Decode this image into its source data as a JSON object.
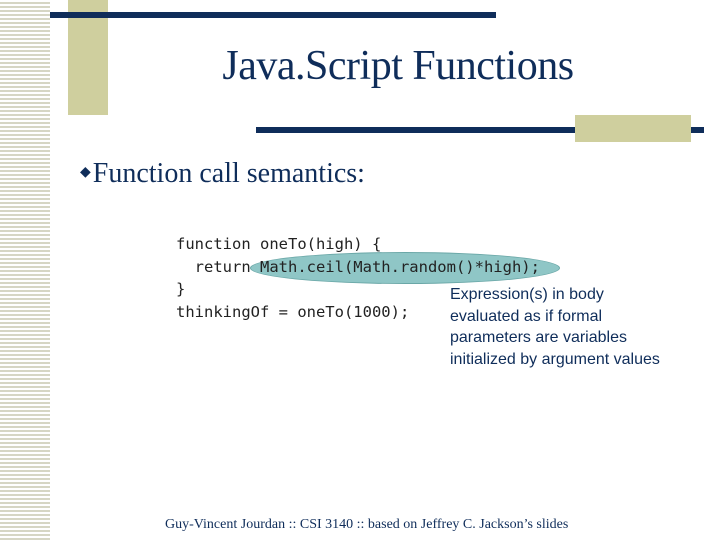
{
  "slide": {
    "title": "Java.Script Functions",
    "bullet": {
      "icon": "diamond-bullet-icon",
      "glyph": "◆",
      "text": "Function call semantics:"
    },
    "code_lines": [
      "function oneTo(high) {",
      "  return Math.ceil(Math.random()*high);",
      "}",
      "thinkingOf = oneTo(1000);"
    ],
    "annotation": "Expression(s) in body evaluated as if formal parameters are variables initialized by argument values",
    "footer": "Guy-Vincent Jourdan :: CSI 3140 :: based on Jeffrey C. Jackson’s slides"
  },
  "colors": {
    "accent_navy": "#0f2d5a",
    "accent_khaki": "#cfcf9e",
    "highlight_teal": "#8fc6c6"
  }
}
